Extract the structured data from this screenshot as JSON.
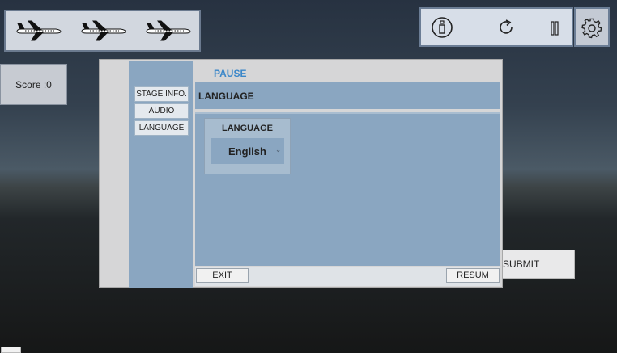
{
  "lives": {
    "count": 3,
    "icon": "airplane-icon"
  },
  "toolbar": {
    "icons": [
      "info-icon",
      "refresh-icon",
      "pause-icon",
      "gear-icon"
    ]
  },
  "score": {
    "label": "Score :0"
  },
  "submit": {
    "label": "SUBMIT"
  },
  "pause_dialog": {
    "title": "PAUSE",
    "tabs": [
      {
        "label": "STAGE INFO."
      },
      {
        "label": "AUDIO"
      },
      {
        "label": "LANGUAGE"
      }
    ],
    "section_header": "LANGUAGE",
    "language_box": {
      "label": "LANGUAGE",
      "selected": "English"
    },
    "exit_label": "EXIT",
    "resume_label": "RESUM"
  }
}
